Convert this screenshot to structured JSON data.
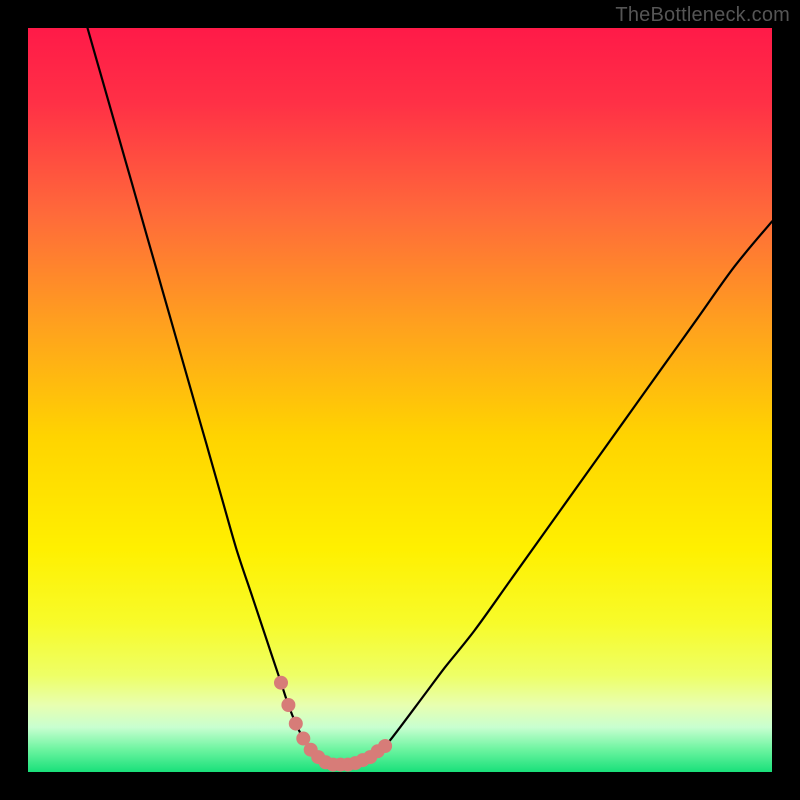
{
  "watermark": "TheBottleneck.com",
  "colors": {
    "frame": "#000000",
    "curve_stroke": "#000000",
    "marker_fill": "#d77c78",
    "gradient_stops": [
      {
        "offset": 0.0,
        "color": "#ff1a48"
      },
      {
        "offset": 0.1,
        "color": "#ff3046"
      },
      {
        "offset": 0.25,
        "color": "#ff6a3a"
      },
      {
        "offset": 0.4,
        "color": "#ffa11e"
      },
      {
        "offset": 0.55,
        "color": "#ffd400"
      },
      {
        "offset": 0.7,
        "color": "#fff000"
      },
      {
        "offset": 0.8,
        "color": "#f7fb2a"
      },
      {
        "offset": 0.87,
        "color": "#eeff66"
      },
      {
        "offset": 0.91,
        "color": "#e8ffb0"
      },
      {
        "offset": 0.94,
        "color": "#c8ffd0"
      },
      {
        "offset": 0.97,
        "color": "#6cf4a0"
      },
      {
        "offset": 1.0,
        "color": "#19e07a"
      }
    ]
  },
  "chart_data": {
    "type": "line",
    "title": "",
    "xlabel": "",
    "ylabel": "",
    "xlim": [
      0,
      100
    ],
    "ylim": [
      0,
      100
    ],
    "grid": false,
    "series": [
      {
        "name": "bottleneck-curve",
        "x": [
          8,
          10,
          12,
          14,
          16,
          18,
          20,
          22,
          24,
          26,
          28,
          30,
          32,
          34,
          35,
          36,
          37,
          38,
          39,
          40,
          41,
          42,
          43,
          44,
          46,
          48,
          50,
          53,
          56,
          60,
          65,
          70,
          75,
          80,
          85,
          90,
          95,
          100
        ],
        "y": [
          100,
          93,
          86,
          79,
          72,
          65,
          58,
          51,
          44,
          37,
          30,
          24,
          18,
          12,
          9,
          6.5,
          4.5,
          3,
          2,
          1.3,
          1,
          1,
          1,
          1.2,
          2,
          3.5,
          6,
          10,
          14,
          19,
          26,
          33,
          40,
          47,
          54,
          61,
          68,
          74
        ]
      }
    ],
    "markers": {
      "name": "highlight-band",
      "x": [
        34,
        35,
        36,
        37,
        38,
        39,
        40,
        41,
        42,
        43,
        44,
        45,
        46,
        47,
        48
      ],
      "y": [
        12,
        9,
        6.5,
        4.5,
        3,
        2,
        1.3,
        1,
        1,
        1,
        1.2,
        1.6,
        2,
        2.8,
        3.5
      ]
    }
  }
}
